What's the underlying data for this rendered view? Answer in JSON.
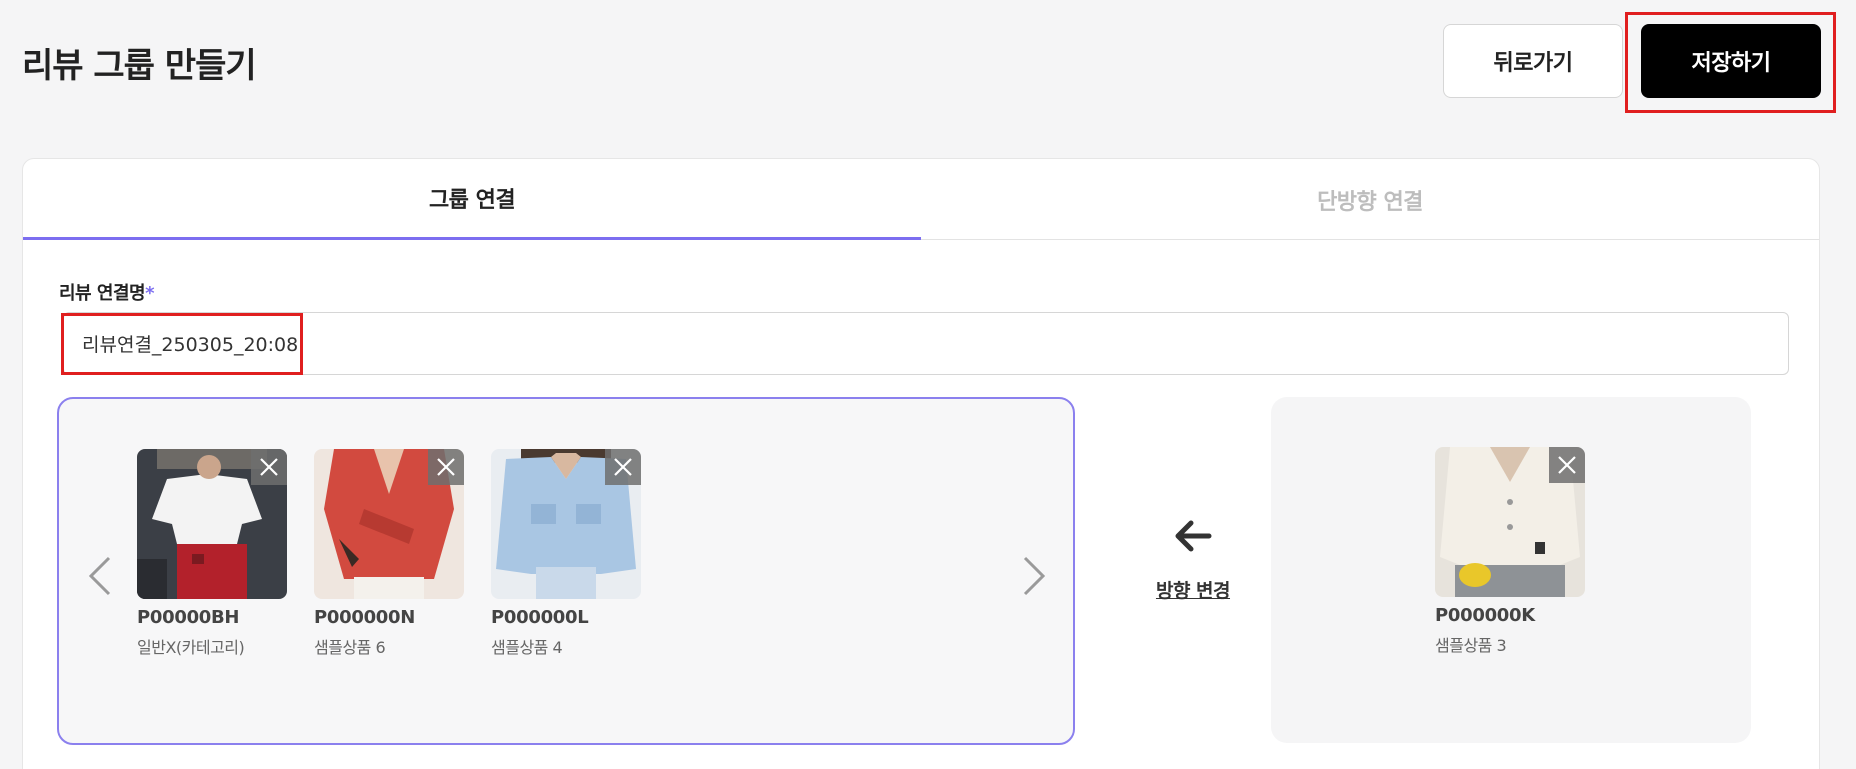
{
  "header": {
    "title": "리뷰 그룹 만들기",
    "back_label": "뒤로가기",
    "save_label": "저장하기"
  },
  "tabs": [
    {
      "label": "그룹 연결",
      "active": true
    },
    {
      "label": "단방향 연결",
      "active": false
    }
  ],
  "form": {
    "name_label": "리뷰 연결명",
    "required_mark": "*",
    "name_value": "리뷰연결_250305_20:08"
  },
  "group_products": [
    {
      "code": "P00000BH",
      "name": "일반X(카테고리)"
    },
    {
      "code": "P000000N",
      "name": "샘플상품 6"
    },
    {
      "code": "P000000L",
      "name": "샘플상품 4"
    }
  ],
  "single_product": {
    "code": "P000000K",
    "name": "샘플상품 3"
  },
  "swap": {
    "label": "방향 변경"
  },
  "colors": {
    "accent": "#7c6ef0",
    "highlight": "#e01f1f",
    "primary_button": "#000000"
  },
  "icons": {
    "prev": "chevron-left-icon",
    "next": "chevron-right-icon",
    "remove": "close-icon",
    "swap": "arrow-left-icon"
  }
}
